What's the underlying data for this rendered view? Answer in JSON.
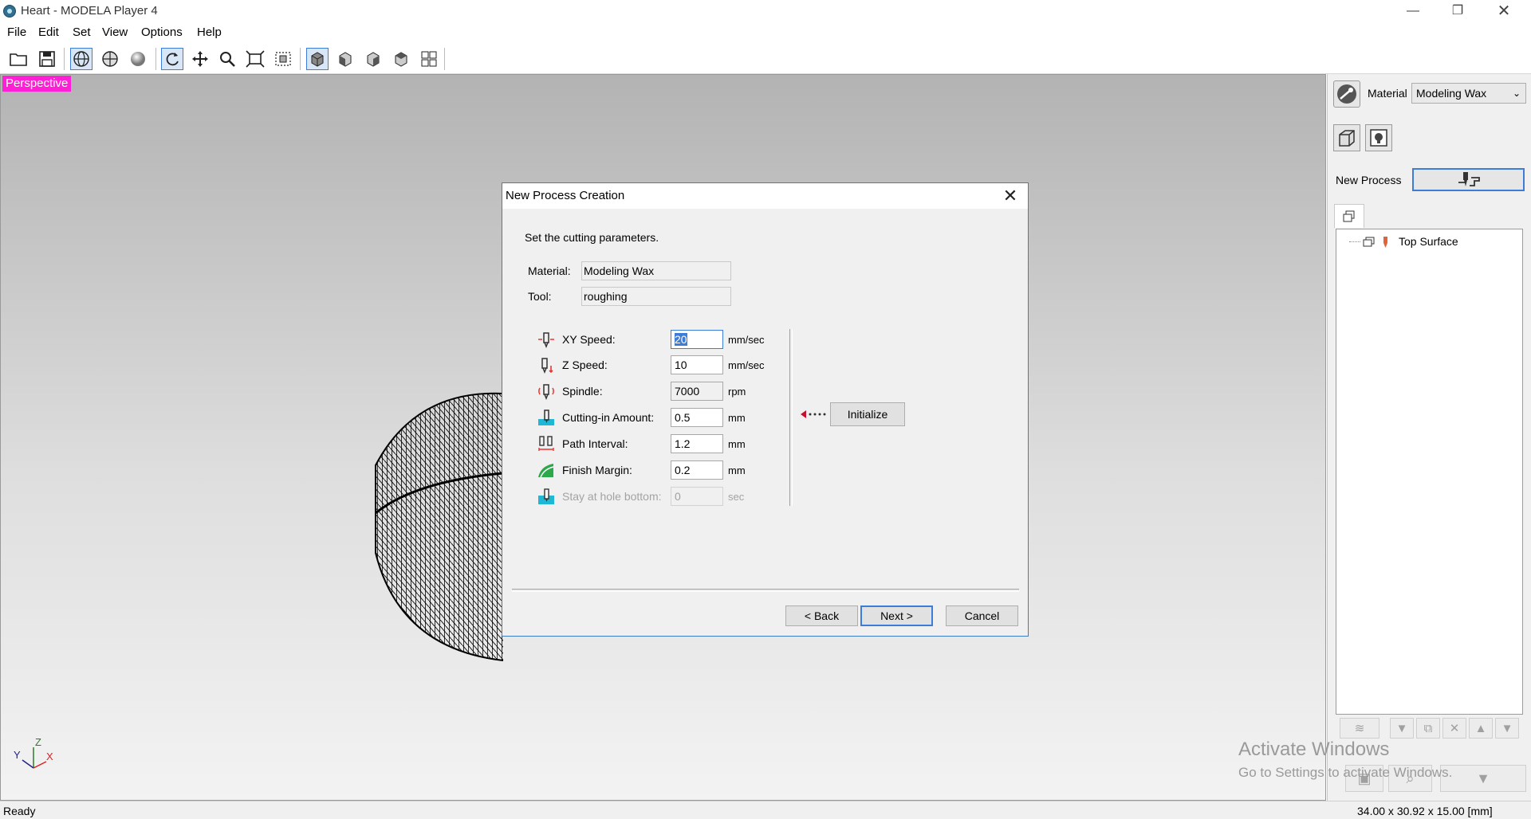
{
  "window": {
    "title": "Heart - MODELA Player 4"
  },
  "menu": [
    "File",
    "Edit",
    "Set",
    "View",
    "Options",
    "Help"
  ],
  "viewport": {
    "label": "Perspective",
    "label_color": "#ff1fd4"
  },
  "right_panel": {
    "material_label": "Material",
    "material_value": "Modeling Wax",
    "new_process_label": "New Process",
    "tree_items": [
      "Top Surface"
    ]
  },
  "watermark": {
    "line1": "Activate Windows",
    "line2": "Go to Settings to activate Windows."
  },
  "status": {
    "left": "Ready",
    "right": "34.00 x 30.92 x 15.00 [mm]"
  },
  "dialog": {
    "title": "New Process Creation",
    "instruction": "Set the cutting parameters.",
    "material_label": "Material:",
    "material_value": "Modeling Wax",
    "tool_label": "Tool:",
    "tool_value": "roughing",
    "params": [
      {
        "label": "XY Speed:",
        "value": "20",
        "unit": "mm/sec",
        "enabled": true
      },
      {
        "label": "Z Speed:",
        "value": "10",
        "unit": "mm/sec",
        "enabled": true
      },
      {
        "label": "Spindle:",
        "value": "7000",
        "unit": "rpm",
        "enabled": true
      },
      {
        "label": "Cutting-in Amount:",
        "value": "0.5",
        "unit": "mm",
        "enabled": true
      },
      {
        "label": "Path Interval:",
        "value": "1.2",
        "unit": "mm",
        "enabled": true
      },
      {
        "label": "Finish Margin:",
        "value": "0.2",
        "unit": "mm",
        "enabled": true
      },
      {
        "label": "Stay at hole bottom:",
        "value": "0",
        "unit": "sec",
        "enabled": false
      }
    ],
    "initialize_label": "Initialize",
    "back_label": "< Back",
    "next_label": "Next >",
    "cancel_label": "Cancel"
  },
  "axis": {
    "x": "X",
    "y": "Y",
    "z": "Z"
  },
  "colors": {
    "accent": "#3d7dd8",
    "dialog_border": "#3f7cc6",
    "status_bg": "#f0f0f0"
  }
}
